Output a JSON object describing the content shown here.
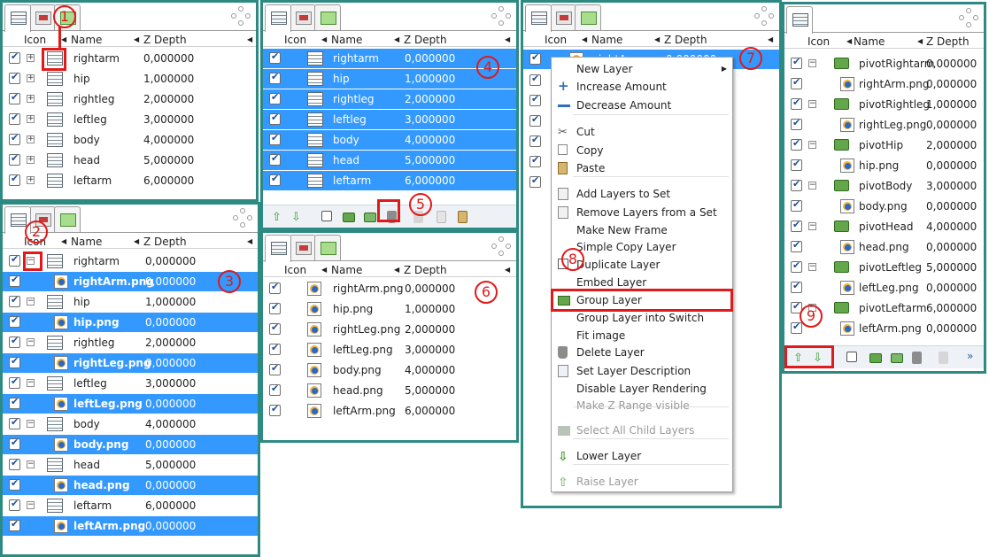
{
  "headers": {
    "icon": "Icon",
    "name": "Name",
    "zdepth": "Z Depth"
  },
  "annotations": [
    "1",
    "2",
    "3",
    "4",
    "5",
    "6",
    "7",
    "8",
    "9"
  ],
  "panel1": {
    "rows": [
      {
        "name": "rightarm",
        "z": "0,000000"
      },
      {
        "name": "hip",
        "z": "1,000000"
      },
      {
        "name": "rightleg",
        "z": "2,000000"
      },
      {
        "name": "leftleg",
        "z": "3,000000"
      },
      {
        "name": "body",
        "z": "4,000000"
      },
      {
        "name": "head",
        "z": "5,000000"
      },
      {
        "name": "leftarm",
        "z": "6,000000"
      }
    ]
  },
  "panel2": {
    "rows": [
      {
        "name": "rightarm",
        "z": "0,000000",
        "type": "layer",
        "sel": false
      },
      {
        "name": "rightArm.png",
        "z": "0,000000",
        "type": "img",
        "sel": true
      },
      {
        "name": "hip",
        "z": "1,000000",
        "type": "layer",
        "sel": false
      },
      {
        "name": "hip.png",
        "z": "0,000000",
        "type": "img",
        "sel": true
      },
      {
        "name": "rightleg",
        "z": "2,000000",
        "type": "layer",
        "sel": false
      },
      {
        "name": "rightLeg.png",
        "z": "0,000000",
        "type": "img",
        "sel": true
      },
      {
        "name": "leftleg",
        "z": "3,000000",
        "type": "layer",
        "sel": false
      },
      {
        "name": "leftLeg.png",
        "z": "0,000000",
        "type": "img",
        "sel": true
      },
      {
        "name": "body",
        "z": "4,000000",
        "type": "layer",
        "sel": false
      },
      {
        "name": "body.png",
        "z": "0,000000",
        "type": "img",
        "sel": true
      },
      {
        "name": "head",
        "z": "5,000000",
        "type": "layer",
        "sel": false
      },
      {
        "name": "head.png",
        "z": "0,000000",
        "type": "img",
        "sel": true
      },
      {
        "name": "leftarm",
        "z": "6,000000",
        "type": "layer",
        "sel": false
      },
      {
        "name": "leftArm.png",
        "z": "0,000000",
        "type": "img",
        "sel": true
      }
    ]
  },
  "panel3": {
    "rows": [
      {
        "name": "rightarm",
        "z": "0,000000"
      },
      {
        "name": "hip",
        "z": "1,000000"
      },
      {
        "name": "rightleg",
        "z": "2,000000"
      },
      {
        "name": "leftleg",
        "z": "3,000000"
      },
      {
        "name": "body",
        "z": "4,000000"
      },
      {
        "name": "head",
        "z": "5,000000"
      },
      {
        "name": "leftarm",
        "z": "6,000000"
      }
    ]
  },
  "panel4": {
    "rows": [
      {
        "name": "rightArm.png",
        "z": "0,000000"
      },
      {
        "name": "hip.png",
        "z": "1,000000"
      },
      {
        "name": "rightLeg.png",
        "z": "2,000000"
      },
      {
        "name": "leftLeg.png",
        "z": "3,000000"
      },
      {
        "name": "body.png",
        "z": "4,000000"
      },
      {
        "name": "head.png",
        "z": "5,000000"
      },
      {
        "name": "leftArm.png",
        "z": "6,000000"
      }
    ]
  },
  "panel5": {
    "partial_row": {
      "name": "rightArm",
      "z": "0,000000"
    }
  },
  "menu": {
    "items": [
      {
        "label": "New Layer",
        "disabled": false,
        "icon": "",
        "submenu": true
      },
      {
        "label": "Increase Amount",
        "disabled": false,
        "icon": "plus-icon"
      },
      {
        "label": "Decrease Amount",
        "disabled": false,
        "icon": "minus-icon"
      },
      {
        "label": "Cut",
        "disabled": false,
        "icon": "scissors-icon"
      },
      {
        "label": "Copy",
        "disabled": false,
        "icon": "copy-icon"
      },
      {
        "label": "Paste",
        "disabled": false,
        "icon": "paste-icon"
      },
      {
        "label": "Add Layers to Set",
        "disabled": false,
        "icon": "add-set-icon"
      },
      {
        "label": "Remove Layers from a Set",
        "disabled": false,
        "icon": "remove-set-icon"
      },
      {
        "label": "Make New Frame",
        "disabled": false,
        "icon": ""
      },
      {
        "label": "Simple Copy Layer",
        "disabled": false,
        "icon": ""
      },
      {
        "label": "Duplicate Layer",
        "disabled": false,
        "icon": "duplicate-icon"
      },
      {
        "label": "Embed Layer",
        "disabled": false,
        "icon": ""
      },
      {
        "label": "Group Layer",
        "disabled": false,
        "icon": "folder-icon"
      },
      {
        "label": "Group Layer into Switch",
        "disabled": false,
        "icon": ""
      },
      {
        "label": "Fit image",
        "disabled": false,
        "icon": ""
      },
      {
        "label": "Delete Layer",
        "disabled": false,
        "icon": "trash-icon"
      },
      {
        "label": "Set Layer Description",
        "disabled": false,
        "icon": "edit-icon"
      },
      {
        "label": "Disable Layer Rendering",
        "disabled": false,
        "icon": ""
      },
      {
        "label": "Make Z Range visible",
        "disabled": true,
        "icon": ""
      },
      {
        "label": "Select All Child Layers",
        "disabled": true,
        "icon": "select-child-icon"
      },
      {
        "label": "Lower Layer",
        "disabled": false,
        "icon": "down-arrow-icon"
      },
      {
        "label": "Raise Layer",
        "disabled": true,
        "icon": "up-arrow-icon"
      }
    ]
  },
  "panel6": {
    "rows": [
      {
        "name": "pivotRightarm",
        "z": "0,000000",
        "type": "folder"
      },
      {
        "name": "rightArm.png",
        "z": "0,000000",
        "type": "img"
      },
      {
        "name": "pivotRightleg",
        "z": "1,000000",
        "type": "folder"
      },
      {
        "name": "rightLeg.png",
        "z": "0,000000",
        "type": "img"
      },
      {
        "name": "pivotHip",
        "z": "2,000000",
        "type": "folder"
      },
      {
        "name": "hip.png",
        "z": "0,000000",
        "type": "img"
      },
      {
        "name": "pivotBody",
        "z": "3,000000",
        "type": "folder"
      },
      {
        "name": "body.png",
        "z": "0,000000",
        "type": "img"
      },
      {
        "name": "pivotHead",
        "z": "4,000000",
        "type": "folder"
      },
      {
        "name": "head.png",
        "z": "0,000000",
        "type": "img"
      },
      {
        "name": "pivotLeftleg",
        "z": "5,000000",
        "type": "folder"
      },
      {
        "name": "leftLeg.png",
        "z": "0,000000",
        "type": "img"
      },
      {
        "name": "pivotLeftarm",
        "z": "6,000000",
        "type": "folder"
      },
      {
        "name": "leftArm.png",
        "z": "0,000000",
        "type": "img"
      }
    ]
  },
  "more_label": "»"
}
